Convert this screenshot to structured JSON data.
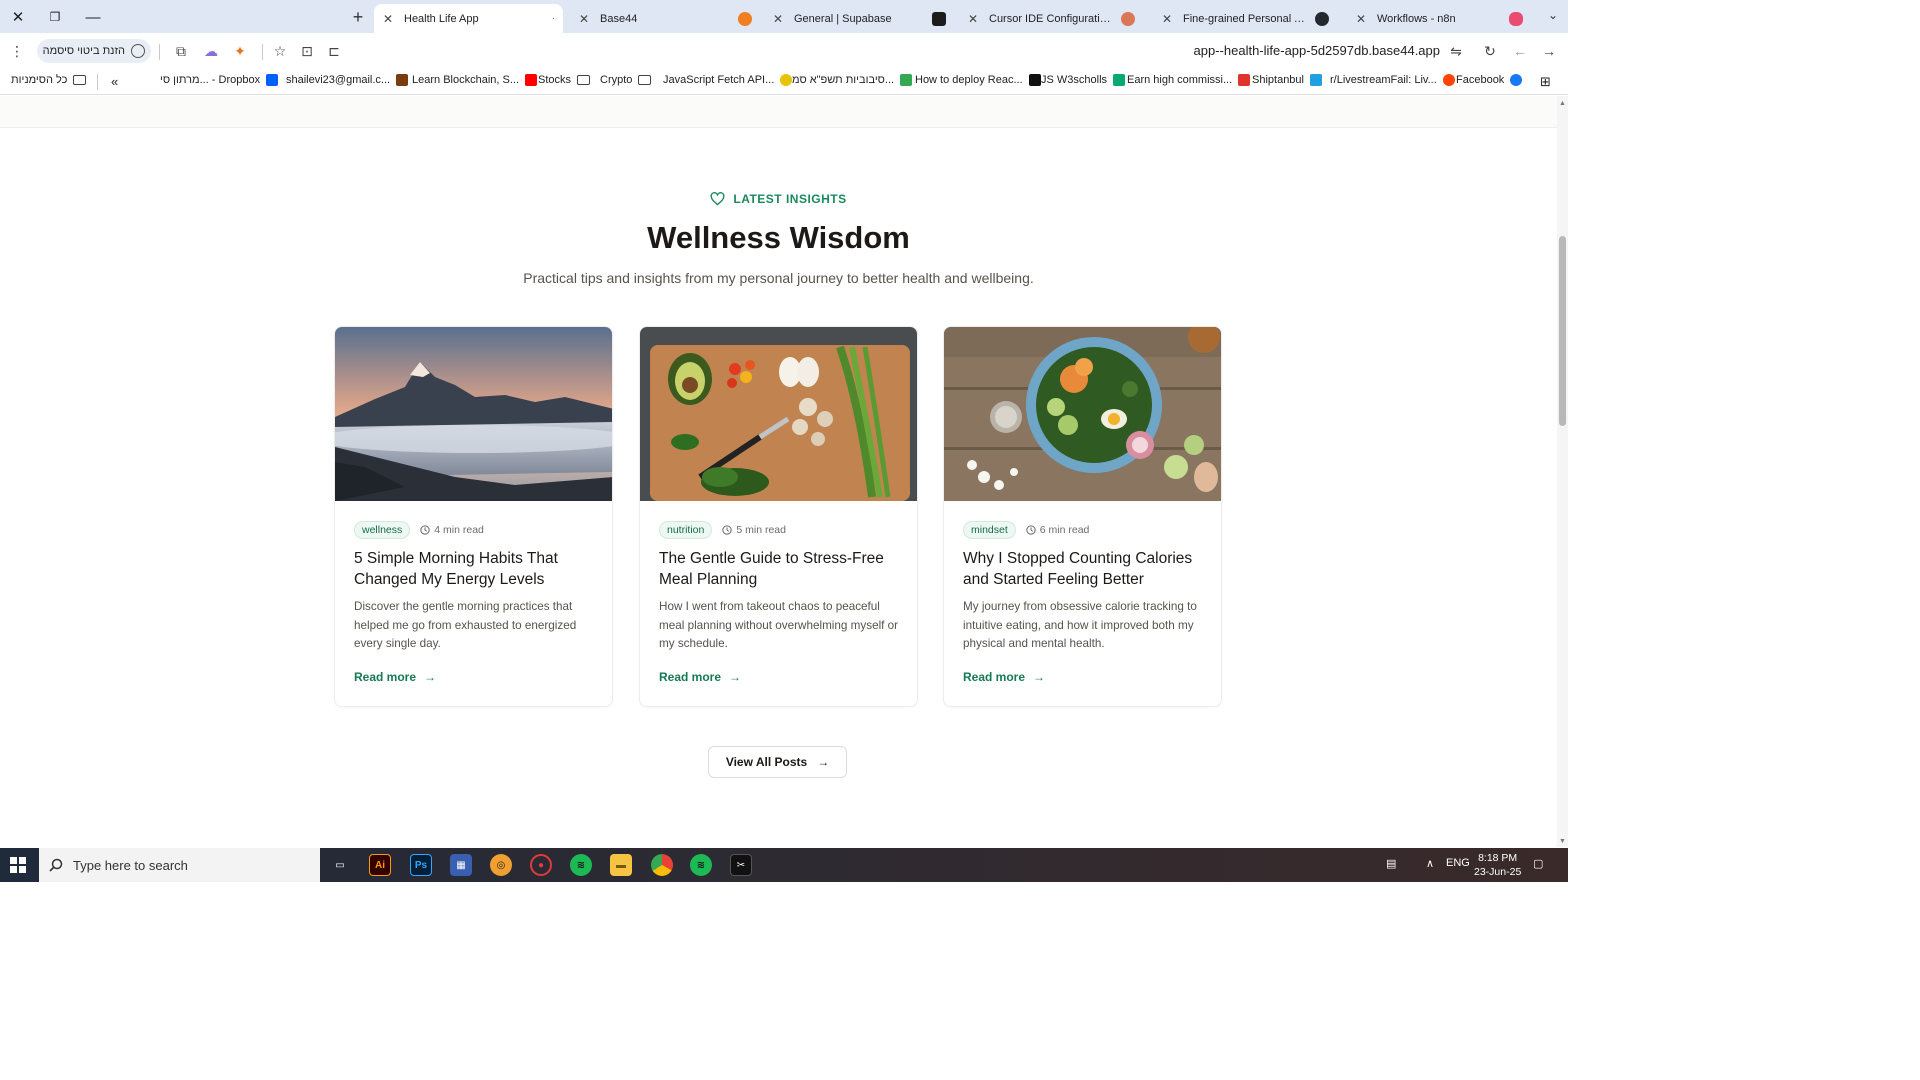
{
  "browser": {
    "tabs": [
      {
        "label": "Health Life App",
        "active": true,
        "favicon_color": "#f28c38"
      },
      {
        "label": "Base44",
        "active": false,
        "favicon_color": "#ef7f22"
      },
      {
        "label": "General | Supabase",
        "active": false,
        "favicon_color": "#1f8a4c"
      },
      {
        "label": "Cursor IDE Configuration Guide",
        "active": false,
        "favicon_color": "#d97757"
      },
      {
        "label": "Fine-grained Personal Access To",
        "active": false,
        "favicon_color": "#24292f"
      },
      {
        "label": "Workflows - n8n",
        "active": false,
        "favicon_color": "#ea4b71"
      }
    ],
    "password_chip_label": "הזנת ביטוי סיסמה",
    "url": "app--health-life-app-5d2597db.base44.app",
    "bookmarks_all_label": "כל הסימניות",
    "bookmarks": [
      {
        "label": "Facebook",
        "color": "#1877f2"
      },
      {
        "label": "r/LivestreamFail: Liv...",
        "color": "#ff4500"
      },
      {
        "label": "Shiptanbul",
        "color": "#1fa0e0"
      },
      {
        "label": "Earn high commissi...",
        "color": "#e0332b"
      },
      {
        "label": "JS W3scholls",
        "color": "#04aa6d"
      },
      {
        "label": "How to deploy Reac...",
        "color": "#111111"
      },
      {
        "label": "סיבוביות תשפ\"א סמ...",
        "color": "#34a853"
      },
      {
        "label": "JavaScript Fetch API...",
        "color": "#e8c400"
      },
      {
        "label": "Crypto",
        "color": "folder"
      },
      {
        "label": "Stocks",
        "color": "folder"
      },
      {
        "label": "Learn Blockchain, S...",
        "color": "#ff0000"
      },
      {
        "label": "shailevi23@gmail.c...",
        "color": "#7a3b10"
      },
      {
        "label": "מרתון סי... - Dropbox",
        "color": "#0061fe"
      }
    ]
  },
  "section": {
    "eyebrow": "LATEST INSIGHTS",
    "title": "Wellness Wisdom",
    "subtitle": "Practical tips and insights from my personal journey to better health and wellbeing.",
    "accent_color": "#1a8a5c"
  },
  "posts": [
    {
      "tag": "wellness",
      "read_time": "4 min read",
      "title": "5 Simple Morning Habits That Changed My Energy Levels",
      "excerpt": "Discover the gentle morning practices that helped me go from exhausted to energized every single day.",
      "read_more": "Read more",
      "image": "mountain-sunrise"
    },
    {
      "tag": "nutrition",
      "read_time": "5 min read",
      "title": "The Gentle Guide to Stress-Free Meal Planning",
      "excerpt": "How I went from takeout chaos to peaceful meal planning without overwhelming myself or my schedule.",
      "read_more": "Read more",
      "image": "vegetables-cutting-board"
    },
    {
      "tag": "mindset",
      "read_time": "6 min read",
      "title": "Why I Stopped Counting Calories and Started Feeling Better",
      "excerpt": "My journey from obsessive calorie tracking to intuitive eating, and how it improved both my physical and mental health.",
      "read_more": "Read more",
      "image": "salad-bowl"
    }
  ],
  "view_all_label": "View All Posts",
  "taskbar": {
    "search_placeholder": "Type here to search",
    "language": "ENG",
    "time": "8:18 PM",
    "date": "23-Jun-25"
  }
}
